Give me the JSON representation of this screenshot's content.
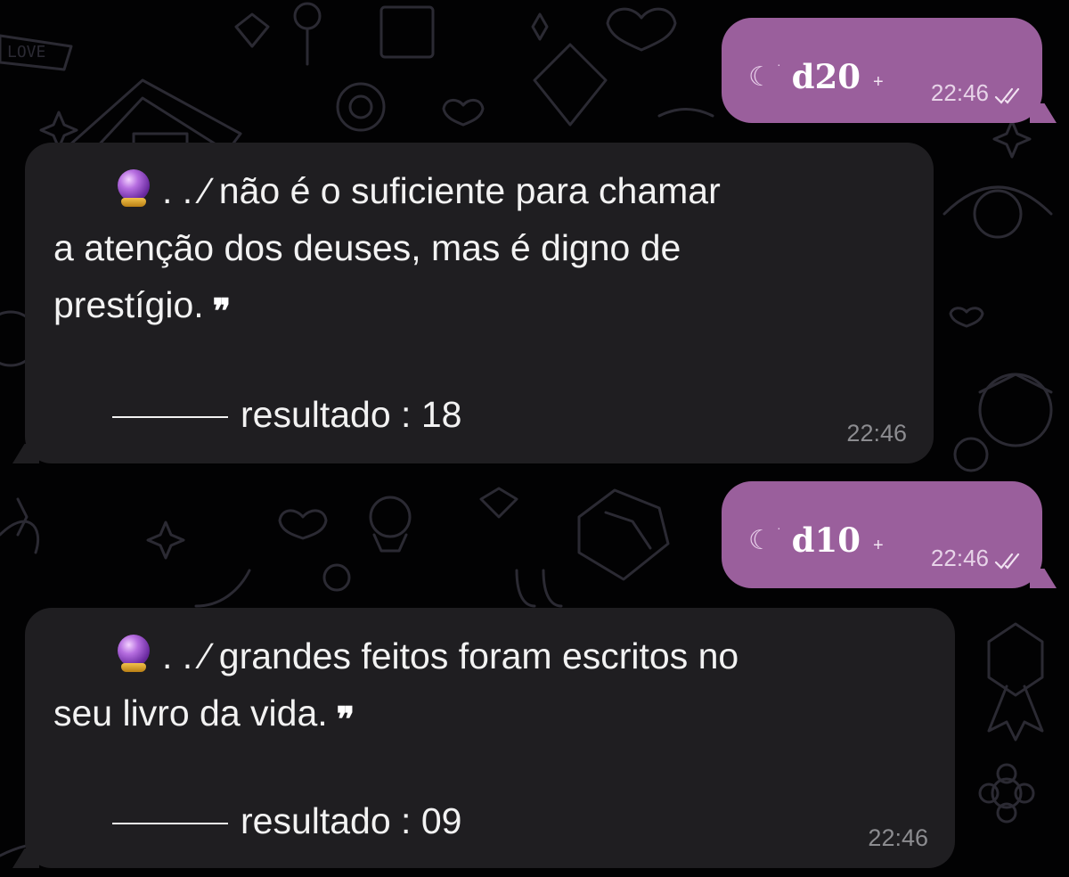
{
  "theme": {
    "background": "#020203",
    "outgoing_bubble": "#9a5f9c",
    "incoming_bubble": "#1f1e21",
    "timestamp_incoming": "#8c8c90"
  },
  "messages": [
    {
      "direction": "outgoing",
      "moon_glyph": "☾",
      "dot_glyph": "·",
      "command": "d20",
      "suffix": "+",
      "time": "22:46",
      "status_icon": "double-check-icon"
    },
    {
      "direction": "incoming",
      "emoji_icon": "crystal-ball-icon",
      "text": ". . ⁄ não é o suficiente para chamar\na atenção dos deuses, mas é digno de\nprestígio.",
      "quote_glyph": "❞",
      "result_label": "resultado : 18",
      "time": "22:46"
    },
    {
      "direction": "outgoing",
      "moon_glyph": "☾",
      "dot_glyph": "·",
      "command": "d10",
      "suffix": "+",
      "time": "22:46",
      "status_icon": "double-check-icon"
    },
    {
      "direction": "incoming",
      "emoji_icon": "crystal-ball-icon",
      "text": ". . ⁄ grandes feitos foram escritos no\nseu livro da vida.",
      "quote_glyph": "❞",
      "result_label": "resultado : 09",
      "time": "22:46"
    }
  ],
  "wallpaper": {
    "label": "LOVE",
    "line_color": "#2b2a33"
  }
}
